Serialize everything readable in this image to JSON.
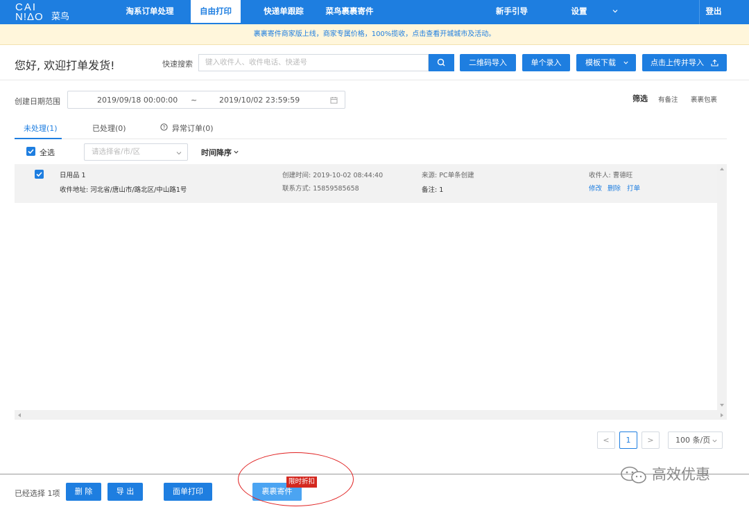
{
  "brand": {
    "logo_line1": "CAI",
    "logo_line2": "N!ΔO",
    "logo_cn": "菜鸟"
  },
  "nav": {
    "items": [
      {
        "label": "淘系订单处理"
      },
      {
        "label": "自由打印"
      },
      {
        "label": "快递单跟踪"
      },
      {
        "label": "菜鸟裹裹寄件"
      },
      {
        "label": "新手引导"
      },
      {
        "label": "设置"
      }
    ],
    "active_index": 1,
    "logout": "登出"
  },
  "banner": {
    "text": "裹裹寄件商家版上线，商家专属价格，100%揽收，点击查看开城城市及活动。"
  },
  "header": {
    "greeting": "您好, 欢迎打单发货!",
    "search_label": "快速搜索",
    "search_placeholder": "键入收件人、收件电话、快递号",
    "buttons": {
      "qr_import": "二维码导入",
      "single_entry": "单个录入",
      "template_download": "模板下载",
      "upload_import": "点击上传并导入"
    }
  },
  "filters": {
    "date_label": "创建日期范围",
    "date_start": "2019/09/18 00:00:00",
    "date_sep": "~",
    "date_end": "2019/10/02 23:59:59",
    "filter_title": "筛选",
    "filter_options": [
      "有备注",
      "裹裹包裹"
    ]
  },
  "tabs": [
    {
      "label": "未处理(1)"
    },
    {
      "label": "已处理(0)"
    },
    {
      "label": "异常订单(0)"
    }
  ],
  "toolbar": {
    "select_all": "全选",
    "region_placeholder": "请选择省/市/区",
    "sort_label": "时间降序"
  },
  "orders": [
    {
      "item": "日用品 1",
      "address": "收件地址: 河北省/唐山市/路北区/中山路1号",
      "created": "创建时间: 2019-10-02 08:44:40",
      "contact": "联系方式: 15859585658",
      "source": "来源: PC单条创建",
      "remark": "备注: 1",
      "recipient": "收件人: 曹德旺",
      "actions": {
        "edit": "修改",
        "delete": "删除",
        "print": "打单"
      }
    }
  ],
  "pagination": {
    "prev": "<",
    "current": "1",
    "next": ">",
    "page_size": "100 条/页"
  },
  "footer": {
    "selected_text": "已经选择 1项",
    "delete": "删 除",
    "export": "导 出",
    "waybill_print": "面单打印",
    "guoguo_send": "裹裹寄件",
    "promo_badge": "限时折扣"
  },
  "watermark": {
    "text": "高效优惠"
  },
  "colors": {
    "primary": "#1e7ee0",
    "banner_bg": "#fff6db",
    "promo_red": "#d4281f",
    "annotation_red": "#e02020"
  }
}
